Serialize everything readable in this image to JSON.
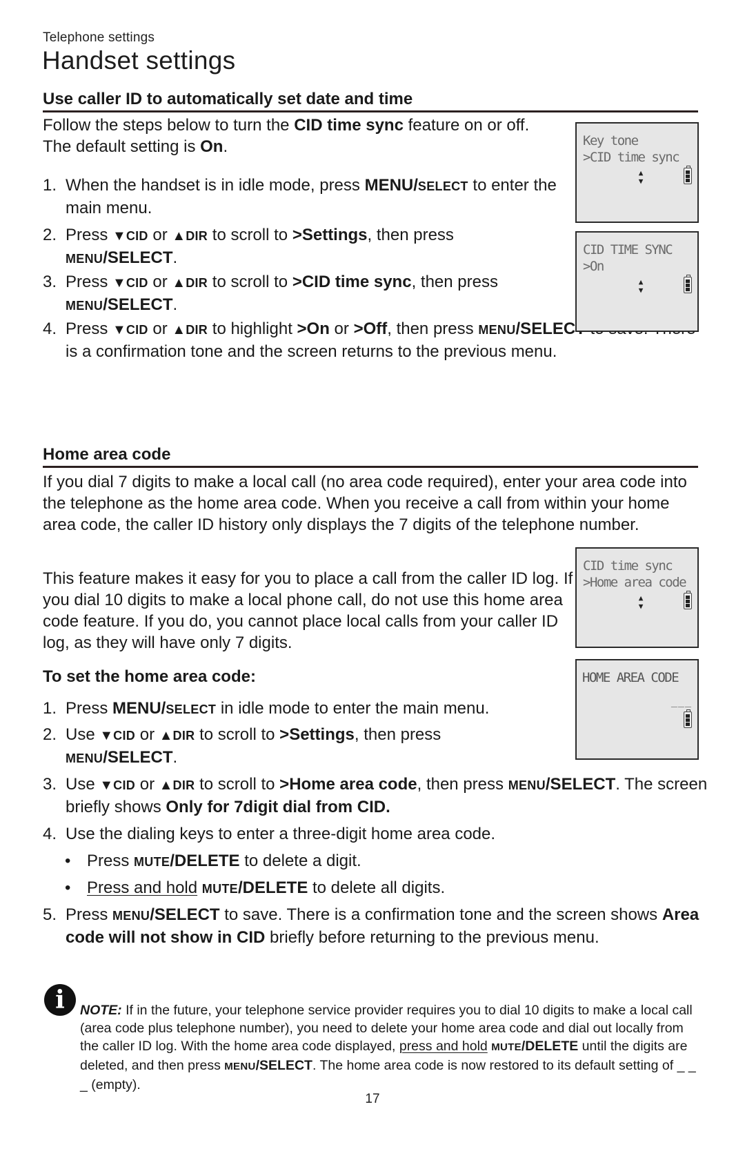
{
  "header": {
    "breadcrumb": "Telephone settings",
    "title": "Handset settings"
  },
  "cid_section": {
    "heading": "Use caller ID to automatically set date and time",
    "intro": {
      "t1": "Follow the steps below to turn the ",
      "b1": "CID time sync",
      "t2": " feature on or off. The default setting is ",
      "b2": "On",
      "t3": "."
    },
    "steps": [
      {
        "num": "1.",
        "t1": "When the handset is in idle mode, press ",
        "k1": "MENU/",
        "k1sc": "SELECT",
        "t2": " to enter the main menu."
      },
      {
        "num": "2.",
        "t1": "Press ",
        "down": "▼",
        "down_label": "CID",
        "or": " or ",
        "up": "▲",
        "up_label": "DIR",
        "t2": " to scroll to ",
        "b1": ">Settings",
        "t3": ", then press ",
        "ksc": "MENU",
        "k": "/SELECT",
        "t4": "."
      },
      {
        "num": "3.",
        "t1": "Press ",
        "down": "▼",
        "down_label": "CID",
        "or": " or ",
        "up": "▲",
        "up_label": "DIR",
        "t2": " to scroll to ",
        "b1": ">CID time sync",
        "t3": ", then press ",
        "ksc": "MENU",
        "k": "/SELECT",
        "t4": "."
      },
      {
        "num": "4.",
        "t1": "Press ",
        "down": "▼",
        "down_label": "CID",
        "or": " or ",
        "up": "▲",
        "up_label": "DIR",
        "t2": " to highlight ",
        "b1": ">On",
        "t3": " or ",
        "b2": ">Off",
        "t4": ", then press ",
        "ksc": "MENU",
        "k": "/SELECT",
        "t5": " to save. There is a confirmation tone and the screen returns to the previous menu."
      }
    ],
    "screens": [
      {
        "line1": " Key tone",
        "line2": ">CID time sync"
      },
      {
        "line1": " CID TIME SYNC",
        "line2": ">On"
      }
    ]
  },
  "home_section": {
    "heading": "Home area code",
    "para1": "If you dial 7 digits to make a local call (no area code required), enter your area code into the telephone as the home area code. When you receive a call from within your home area code, the caller ID history only displays the 7 digits of the telephone number.",
    "para2": "This feature makes it easy for you to place a call from the caller ID log. If you dial 10 digits to make a local phone call, do not use this home area code feature. If you do, you cannot place local calls from your caller ID log, as they will have only 7 digits.",
    "subheading": "To set the home area code:",
    "steps": [
      {
        "num": "1.",
        "t1": "Press ",
        "k1": "MENU/",
        "k1sc": "SELECT",
        "t2": " in idle mode to enter the main menu."
      },
      {
        "num": "2.",
        "t1": "Use ",
        "down": "▼",
        "down_label": "CID",
        "or": " or ",
        "up": "▲",
        "up_label": "DIR",
        "t2": " to scroll to ",
        "b1": ">Settings",
        "t3": ", then press ",
        "ksc": "MENU",
        "k": "/SELECT",
        "t4": "."
      },
      {
        "num": "3.",
        "t1": "Use ",
        "down": "▼",
        "down_label": "CID",
        "or": " or ",
        "up": "▲",
        "up_label": "DIR",
        "t2": " to scroll to ",
        "b1": ">Home area code",
        "t3": ", then press ",
        "ksc": "MENU",
        "k": "/SELECT",
        "t4": ". The screen briefly shows ",
        "b2": "Only for 7digit dial from CID."
      },
      {
        "num": "4.",
        "t1": "Use the dialing keys to enter a three-digit home area code."
      },
      {
        "num": "5.",
        "t1": "Press ",
        "ksc": "MENU",
        "k": "/SELECT",
        "t2": " to save. There is a confirmation tone and the screen shows ",
        "b1": "Area code will not show in CID",
        "t3": " briefly before returning to the previous menu."
      }
    ],
    "bullets": [
      {
        "dot": "•",
        "t1": "Press ",
        "ksc": "MUTE",
        "k": "/DELETE",
        "t2": " to delete a digit."
      },
      {
        "dot": "•",
        "u": "Press and hold",
        "t1": " ",
        "ksc": "MUTE",
        "k": "/DELETE",
        "t2": " to delete all digits."
      }
    ],
    "screens": [
      {
        "line1": " CID time sync",
        "line2": ">Home area code"
      },
      {
        "line1": "HOME AREA CODE",
        "dash": "___"
      }
    ]
  },
  "note": {
    "icon": "i",
    "label": "NOTE:",
    "t1": " If in the future, your telephone service provider requires you to dial 10 digits to make a local call (area code plus telephone number), you need to delete your home area code and dial out locally from the caller ID log. With the home area code displayed, ",
    "u": "press and hold",
    "t2": " ",
    "ksc1": "MUTE",
    "k1": "/DELETE",
    "t3": " until the digits are deleted, and then press ",
    "ksc2": "MENU",
    "k2": "/SELECT",
    "t4": ". The home area code is now restored to its default setting of _ _ _ (empty)."
  },
  "page_number": "17",
  "lcd_arrows": {
    "up": "▲",
    "down": "▼"
  }
}
